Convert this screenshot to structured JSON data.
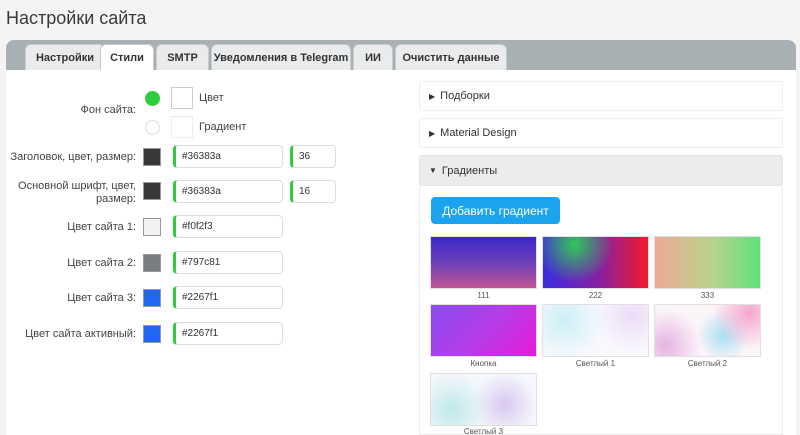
{
  "page": {
    "title": "Настройки сайта"
  },
  "tabs": [
    {
      "label": "Настройки"
    },
    {
      "label": "Стили"
    },
    {
      "label": "SMTP"
    },
    {
      "label": "Уведомления в Telegram"
    },
    {
      "label": "ИИ"
    },
    {
      "label": "Очистить данные"
    }
  ],
  "active_tab": "Стили",
  "form": {
    "background": {
      "label": "Фон сайта:",
      "option_color": "Цвет",
      "option_gradient": "Градиент",
      "selected": "Цвет"
    },
    "heading": {
      "label": "Заголовок, цвет, размер:",
      "color": "#36383a",
      "size": "36",
      "swatch": "#36383a"
    },
    "body_font": {
      "label": "Основной шрифт, цвет, размер:",
      "color": "#36383a",
      "size": "16",
      "swatch": "#36383a"
    },
    "color1": {
      "label": "Цвет сайта 1:",
      "value": "#f0f2f3",
      "swatch": "#f0f2f3"
    },
    "color2": {
      "label": "Цвет сайта 2:",
      "value": "#797c81",
      "swatch": "#797c81"
    },
    "color3": {
      "label": "Цвет сайта 3:",
      "value": "#2267f1",
      "swatch": "#2267f1"
    },
    "color_active": {
      "label": "Цвет сайта активный:",
      "value": "#2267f1",
      "swatch": "#2267f1"
    }
  },
  "accordions": [
    {
      "label": "Подборки",
      "open": false
    },
    {
      "label": "Material Design",
      "open": false
    },
    {
      "label": "Градиенты",
      "open": true
    }
  ],
  "gradients": {
    "add_button": "Добавить градиент",
    "items": [
      {
        "label": "111"
      },
      {
        "label": "222"
      },
      {
        "label": "333"
      },
      {
        "label": "Кнопка"
      },
      {
        "label": "Светлый 1"
      },
      {
        "label": "Светлый 2"
      },
      {
        "label": "Светлый 3"
      }
    ]
  },
  "colors": {
    "accent_green": "#2ecc40",
    "button_blue": "#1ca3ee",
    "tabbar": "#a9b0b3"
  }
}
